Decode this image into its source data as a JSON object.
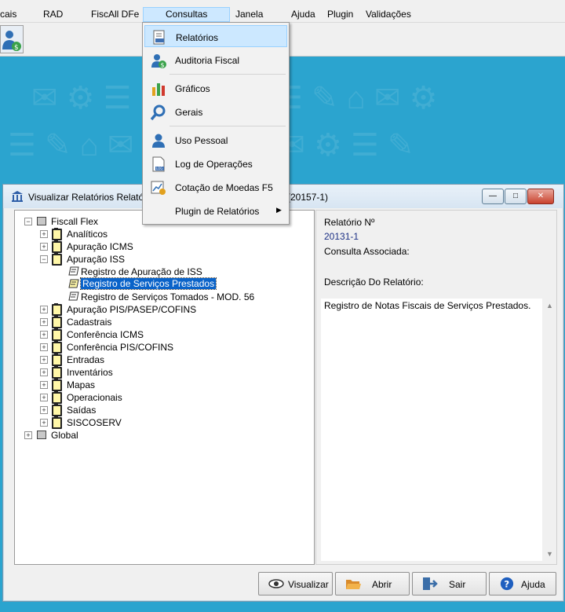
{
  "menubar": {
    "items": [
      "cais",
      "RAD",
      "FiscAll DFe",
      "Consultas",
      "Janela",
      "Ajuda",
      "Plugin",
      "Validações"
    ],
    "active": "Consultas"
  },
  "consultas_menu": {
    "items": [
      {
        "label": "Relatórios",
        "icon": "report-icon",
        "highlighted": true
      },
      {
        "label": "Auditoria Fiscal",
        "icon": "user-money-icon"
      },
      {
        "label": "Gráficos",
        "icon": "bar-chart-icon"
      },
      {
        "label": "Gerais",
        "icon": "magnifier-icon"
      },
      {
        "label": "Uso Pessoal",
        "icon": "user-icon"
      },
      {
        "label": "Log de Operações",
        "icon": "log-file-icon"
      },
      {
        "label": "Cotação de Moedas F5",
        "icon": "currency-chart-icon"
      },
      {
        "label": "Plugin de Relatórios",
        "icon": "",
        "submenu": true
      }
    ]
  },
  "window": {
    "title": "Visualizar Relatórios Relatóri",
    "title_suffix": "(20157-1)",
    "controls": {
      "minimize": "—",
      "maximize": "□",
      "close": "✕"
    }
  },
  "tree": {
    "root": "Fiscall Flex",
    "categories": [
      "Analíticos",
      "Apuração ICMS",
      "Apuração ISS",
      "Apuração PIS/PASEP/COFINS",
      "Cadastrais",
      "Conferência ICMS",
      "Conferência PIS/COFINS",
      "Entradas",
      "Inventários",
      "Mapas",
      "Operacionais",
      "Saídas",
      "SISCOSERV"
    ],
    "iss_reports": [
      "Registro de Apuração de ISS",
      "Registro de Serviços Prestados",
      "Registro de Serviços Tomados - MOD. 56"
    ],
    "selected": "Registro de Serviços Prestados",
    "global": "Global",
    "expand_symbol": "+",
    "collapse_symbol": "−"
  },
  "info": {
    "report_number_label": "Relatório Nº",
    "report_number": "20131-1",
    "associated_label": "Consulta Associada:",
    "description_label": "Descrição Do Relatório:",
    "description": "Registro de Notas Fiscais de Serviços Prestados."
  },
  "buttons": {
    "visualizar": "Visualizar",
    "abrir": "Abrir",
    "sair": "Sair",
    "ajuda": "Ajuda"
  },
  "colors": {
    "desktop": "#2ba4cf",
    "selection": "#0a63c9",
    "menu_highlight": "#cce8ff",
    "value_text": "#1b2f84"
  }
}
